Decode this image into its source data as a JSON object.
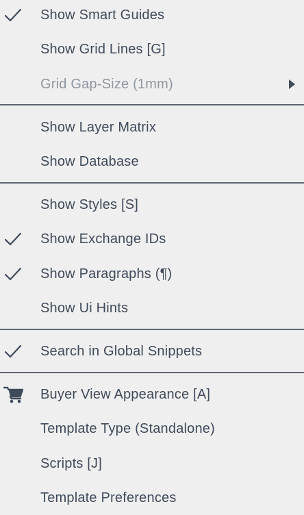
{
  "menu": {
    "items": [
      {
        "label": "Show Smart Guides",
        "checked": true
      },
      {
        "label": "Show Grid Lines [G]",
        "checked": false
      },
      {
        "label": "Grid Gap-Size (1mm)",
        "checked": false,
        "disabled": true,
        "submenu": true
      },
      {
        "label": "Show Layer Matrix",
        "checked": false
      },
      {
        "label": "Show Database",
        "checked": false
      },
      {
        "label": "Show Styles [S]",
        "checked": false
      },
      {
        "label": "Show Exchange IDs",
        "checked": true
      },
      {
        "label": "Show Paragraphs (¶)",
        "checked": true
      },
      {
        "label": "Show Ui Hints",
        "checked": false
      },
      {
        "label": "Search in Global Snippets",
        "checked": true
      },
      {
        "label": "Buyer View Appearance [A]",
        "icon": "cart-icon"
      },
      {
        "label": "Template Type (Standalone)"
      },
      {
        "label": "Scripts [J]"
      },
      {
        "label": "Template Preferences"
      }
    ]
  },
  "colors": {
    "background": "#efefef",
    "text": "#3f4a5a",
    "disabled_text": "#8f96a0",
    "separator": "#5f6670"
  }
}
